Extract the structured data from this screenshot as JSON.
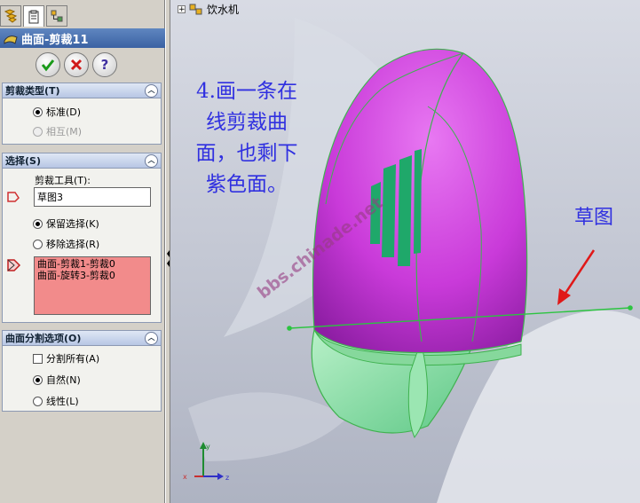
{
  "tabs": [
    {
      "name": "feature-manager-tab-icon",
      "active": false
    },
    {
      "name": "property-manager-tab-icon",
      "active": true
    },
    {
      "name": "configuration-manager-tab-icon",
      "active": false
    }
  ],
  "feature": {
    "title": "曲面-剪裁11"
  },
  "buttons": {
    "ok": "ok",
    "cancel": "cancel",
    "help": "?"
  },
  "trim_type": {
    "header": "剪裁类型(T)",
    "standard": "标准(D)",
    "mutual": "相互(M)"
  },
  "selection": {
    "header": "选择(S)",
    "tool_label": "剪裁工具(T):",
    "tool_value": "草图3",
    "keep": "保留选择(K)",
    "remove": "移除选择(R)",
    "items": [
      "曲面-剪裁1-剪裁0",
      "曲面-旋转3-剪裁0"
    ]
  },
  "split": {
    "header": "曲面分割选项(O)",
    "split_all": "分割所有(A)",
    "natural": "自然(N)",
    "linear": "线性(L)"
  },
  "tree": {
    "root": "饮水机"
  },
  "annotation": {
    "lines": [
      "4.画一条在",
      "线剪裁曲",
      "面，也剩下",
      "紫色面。"
    ],
    "sketch_label": "草图"
  },
  "watermark": "bbs.chinade.net",
  "colors": {
    "accent_blue": "#3030e0",
    "surface_purple": "#cc3fdb",
    "surface_green": "#8fe2a8",
    "list_bg": "#f28b8b",
    "arrow_red": "#e01818"
  }
}
